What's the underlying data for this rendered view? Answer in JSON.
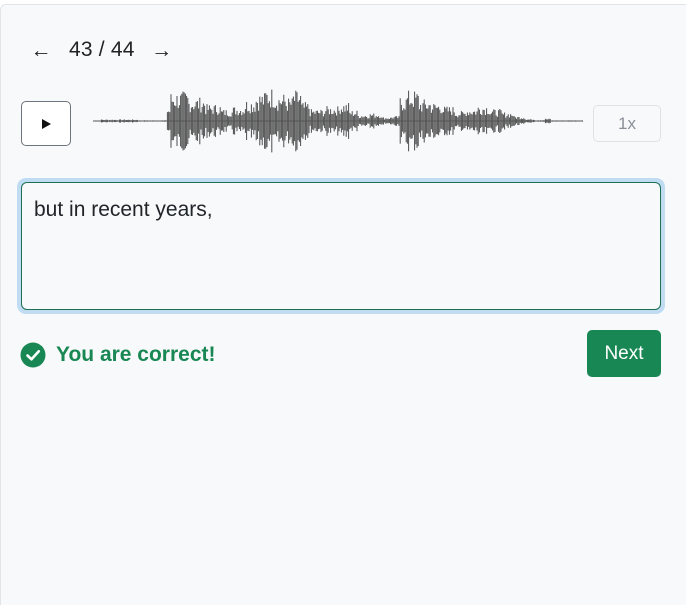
{
  "navigation": {
    "prev_icon": "arrow-left-icon",
    "prev_glyph": "←",
    "next_icon": "arrow-right-icon",
    "next_glyph": "→",
    "counter": "43 / 44",
    "current": 43,
    "total": 44
  },
  "player": {
    "play_icon": "play-icon",
    "speed_label": "1x",
    "waveform_color": "#4d4d4d"
  },
  "answer": {
    "value": "but in recent years,"
  },
  "result": {
    "icon": "check-circle-icon",
    "message": "You are correct!",
    "color": "#198754"
  },
  "actions": {
    "next_label": "Next",
    "next_color": "#198754"
  }
}
